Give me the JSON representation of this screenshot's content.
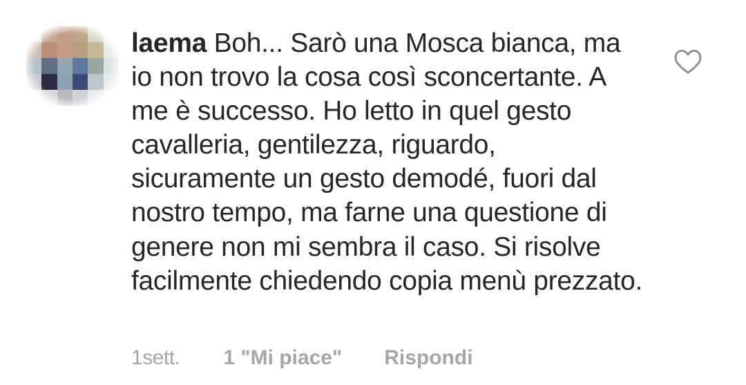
{
  "comment": {
    "username": "laema",
    "text": "Boh... Sarò una Mosca bianca, ma io non trovo la cosa così sconcertante. A me è successo. Ho letto in quel gesto cavalleria, gentilezza, riguardo, sicuramente un gesto demodé, fuori dal nostro tempo, ma farne una questione di genere non mi sembra il caso. Si risolve facilmente chiedendo copia menù prezzato.",
    "like_icon": "heart-outline-icon",
    "meta": {
      "time": "1sett.",
      "likes": "1 \"Mi piace\"",
      "reply": "Rispondi"
    }
  },
  "colors": {
    "text": "#262626",
    "meta_text": "#a6a6a6",
    "icon_stroke": "#8e8e8e",
    "background": "#ffffff"
  }
}
